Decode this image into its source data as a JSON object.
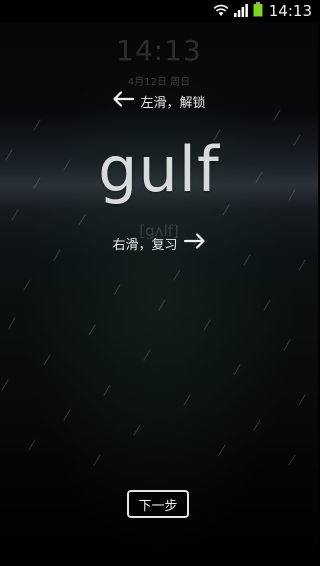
{
  "status_bar": {
    "time": "14:13",
    "icons": [
      "wifi-icon",
      "signal-icon",
      "battery-icon"
    ],
    "battery_color": "#7ed321"
  },
  "lockscreen": {
    "clock": "14:13",
    "date": "4月12日 周日"
  },
  "hints": {
    "left_text": "左滑，解锁",
    "right_text": "右滑，复习"
  },
  "word": {
    "text": "gulf",
    "phonetic": "[gʌlf]"
  },
  "buttons": {
    "next_label": "下一步"
  },
  "colors": {
    "text_primary": "#e8e8e8",
    "background": "#000000"
  }
}
